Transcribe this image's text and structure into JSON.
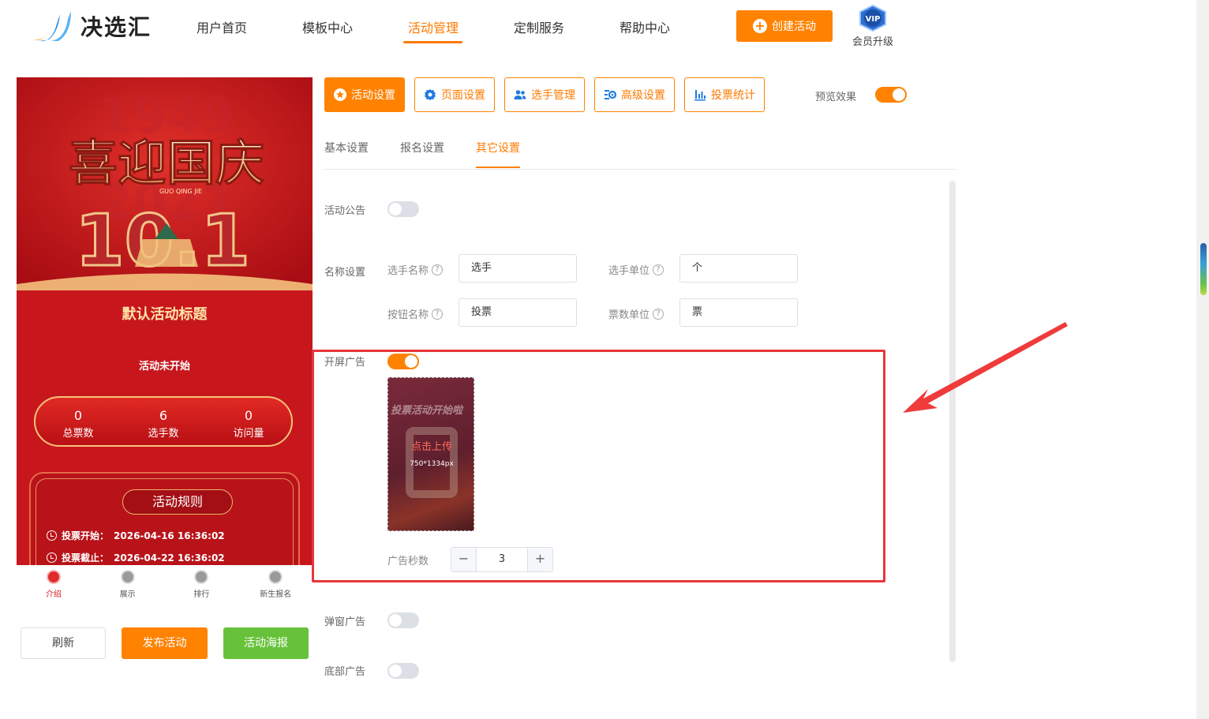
{
  "header": {
    "logo_text": "决选汇",
    "nav": [
      {
        "label": "用户首页",
        "active": false
      },
      {
        "label": "模板中心",
        "active": false
      },
      {
        "label": "活动管理",
        "active": true
      },
      {
        "label": "定制服务",
        "active": false
      },
      {
        "label": "帮助中心",
        "active": false
      }
    ],
    "create_button": "创建活动",
    "vip_badge": "VIP",
    "vip_label": "会员升级"
  },
  "preview": {
    "poster_title": "喜迎国庆",
    "poster_sub": "GUO QING JIE",
    "poster_date": "10.1",
    "activity_title": "默认活动标题",
    "status": "活动未开始",
    "stats": [
      {
        "value": "0",
        "label": "总票数"
      },
      {
        "value": "6",
        "label": "选手数"
      },
      {
        "value": "0",
        "label": "访问量"
      }
    ],
    "rules_title": "活动规则",
    "rules": [
      {
        "label": "投票开始：",
        "value": "2026-04-16 16:36:02"
      },
      {
        "label": "投票截止：",
        "value": "2026-04-22 16:36:02"
      }
    ],
    "tabbar": [
      {
        "label": "介绍",
        "active": true
      },
      {
        "label": "展示",
        "active": false
      },
      {
        "label": "排行",
        "active": false
      },
      {
        "label": "新生报名",
        "active": false
      }
    ],
    "buttons": {
      "refresh": "刷新",
      "publish": "发布活动",
      "poster": "活动海报"
    }
  },
  "settings": {
    "tabs": [
      {
        "label": "活动设置",
        "icon": "star-icon",
        "active": true
      },
      {
        "label": "页面设置",
        "icon": "gear-icon",
        "active": false
      },
      {
        "label": "选手管理",
        "icon": "users-icon",
        "active": false
      },
      {
        "label": "高级设置",
        "icon": "advanced-settings-icon",
        "active": false
      },
      {
        "label": "投票统计",
        "icon": "bar-chart-icon",
        "active": false
      }
    ],
    "preview_label": "预览效果",
    "preview_on": true,
    "subtabs": [
      {
        "label": "基本设置",
        "active": false
      },
      {
        "label": "报名设置",
        "active": false
      },
      {
        "label": "其它设置",
        "active": true
      }
    ],
    "notice": {
      "label": "活动公告",
      "on": false
    },
    "naming": {
      "label": "名称设置",
      "player_name": {
        "label": "选手名称",
        "value": "选手"
      },
      "player_unit": {
        "label": "选手单位",
        "value": "个"
      },
      "button_name": {
        "label": "按钮名称",
        "value": "投票"
      },
      "vote_unit": {
        "label": "票数单位",
        "value": "票"
      },
      "help": "?"
    },
    "splash_ad": {
      "label": "开屏广告",
      "on": true,
      "upload_title": "投票活动开始啦",
      "upload_text": "点击上传",
      "upload_size": "750*1334px",
      "seconds_label": "广告秒数",
      "seconds": "3",
      "minus": "−",
      "plus": "+"
    },
    "popup_ad": {
      "label": "弹窗广告",
      "on": false
    },
    "bottom_ad": {
      "label": "底部广告",
      "on": false
    }
  },
  "colors": {
    "accent": "#ff8200",
    "highlight": "#e8353a",
    "green": "#67c23a",
    "poster_red": "#c8161d"
  }
}
